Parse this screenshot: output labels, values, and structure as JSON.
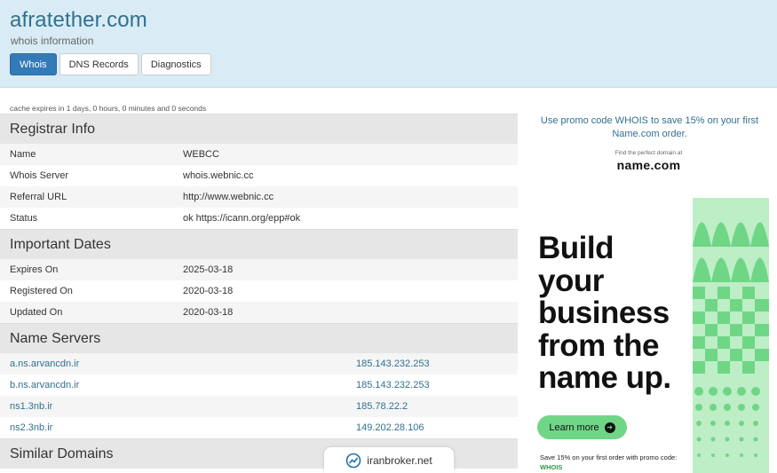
{
  "header": {
    "title": "afratether.com",
    "subtitle": "whois information",
    "tabs": [
      {
        "label": "Whois",
        "active": true
      },
      {
        "label": "DNS Records",
        "active": false
      },
      {
        "label": "Diagnostics",
        "active": false
      }
    ]
  },
  "cache_note": "cache expires in 1 days, 0 hours, 0 minutes and 0 seconds",
  "registrar": {
    "heading": "Registrar Info",
    "rows": [
      {
        "key": "Name",
        "value": "WEBCC"
      },
      {
        "key": "Whois Server",
        "value": "whois.webnic.cc"
      },
      {
        "key": "Referral URL",
        "value": "http://www.webnic.cc"
      },
      {
        "key": "Status",
        "value": "ok https://icann.org/epp#ok"
      }
    ]
  },
  "dates": {
    "heading": "Important Dates",
    "rows": [
      {
        "key": "Expires On",
        "value": "2025-03-18"
      },
      {
        "key": "Registered On",
        "value": "2020-03-18"
      },
      {
        "key": "Updated On",
        "value": "2020-03-18"
      }
    ]
  },
  "nameservers": {
    "heading": "Name Servers",
    "rows": [
      {
        "host": "a.ns.arvancdn.ir",
        "ip": "185.143.232.253"
      },
      {
        "host": "b.ns.arvancdn.ir",
        "ip": "185.143.232.253"
      },
      {
        "host": "ns1.3nb.ir",
        "ip": "185.78.22.2"
      },
      {
        "host": "ns2.3nb.ir",
        "ip": "149.202.28.106"
      }
    ]
  },
  "similar": {
    "heading": "Similar Domains"
  },
  "ad": {
    "promo": "Use promo code WHOIS to save 15% on your first Name.com order.",
    "find_text": "Find the perfect domain at",
    "brand": "name.com",
    "headline_lines": [
      "Build",
      "your",
      "business",
      "from the",
      "name up."
    ],
    "learn_more": "Learn more",
    "save_text": "Save 15% on your first order with promo code:",
    "save_code": "WHOIS",
    "accent_color": "#6fd686"
  },
  "watermark": {
    "text": "iranbroker.net"
  }
}
